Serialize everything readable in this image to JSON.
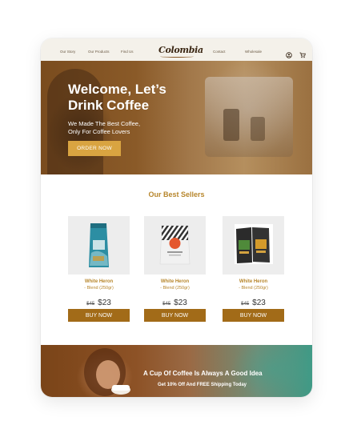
{
  "nav": {
    "links_left": [
      "Our Story",
      "Our Products",
      "Find Us"
    ],
    "logo": "Colombia",
    "links_right": [
      "Contact",
      "Wholesale"
    ],
    "icons": [
      "user-icon",
      "cart-icon"
    ]
  },
  "hero": {
    "title_line1": "Welcome, Let’s",
    "title_line2": "Drink Coffee",
    "subtitle_line1": "We Made The Best Coffee,",
    "subtitle_line2": "Only For Coffee Lovers",
    "cta": "ORDER NOW"
  },
  "best_sellers": {
    "title": "Our Best Sellers",
    "products": [
      {
        "name": "White Heron",
        "variant": "- Blend (250gr)",
        "old_price": "$45",
        "price": "$23",
        "button": "BUY NOW"
      },
      {
        "name": "White Heron",
        "variant": "- Blend (250gr)",
        "old_price": "$45",
        "price": "$23",
        "button": "BUY NOW"
      },
      {
        "name": "White Heron",
        "variant": "- Blend (250gr)",
        "old_price": "$45",
        "price": "$23",
        "button": "BUY NOW"
      }
    ]
  },
  "banner": {
    "headline": "A Cup Of Coffee Is Always A Good Idea",
    "subline": "Get 10% Off And FREE Shipping Today"
  },
  "colors": {
    "accent_gold": "#b7862c",
    "button_brown": "#a26b18",
    "hero_button": "#d9a441"
  }
}
